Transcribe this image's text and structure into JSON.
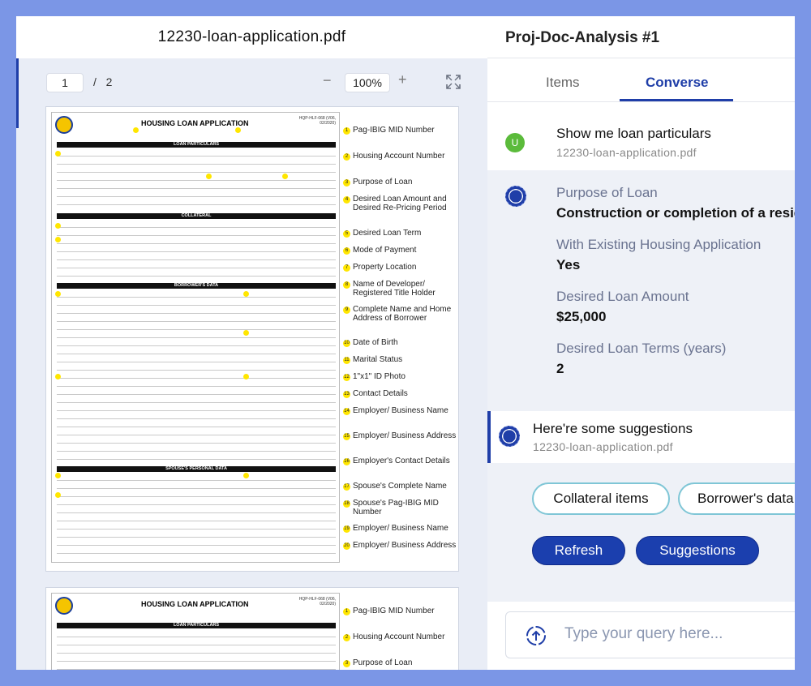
{
  "left_pane": {
    "file_name": "12230-loan-application.pdf",
    "page_current": "1",
    "page_separator": "/",
    "page_total": "2",
    "zoom_minus": "−",
    "zoom_level": "100%",
    "zoom_plus": "+",
    "expand_icon": "expand-arrows-icon"
  },
  "pdf": {
    "title": "HOUSING LOAN APPLICATION",
    "code": "HQP-HLF-068 (V06, 02/2020)",
    "sections": [
      "LOAN PARTICULARS",
      "COLLATERAL",
      "BORROWER'S DATA",
      "SPOUSE'S PERSONAL DATA"
    ],
    "legend": [
      {
        "num": "1",
        "text": "Pag-IBIG MID Number"
      },
      {
        "num": "2",
        "text": "Housing Account Number"
      },
      {
        "num": "3",
        "text": "Purpose of Loan"
      },
      {
        "num": "4",
        "text": "Desired Loan Amount and Desired Re-Pricing Period"
      },
      {
        "num": "5",
        "text": "Desired Loan Term"
      },
      {
        "num": "6",
        "text": "Mode of Payment"
      },
      {
        "num": "7",
        "text": "Property Location"
      },
      {
        "num": "8",
        "text": "Name of Developer/ Registered Title Holder"
      },
      {
        "num": "9",
        "text": "Complete Name and Home Address of Borrower"
      },
      {
        "num": "10",
        "text": "Date of Birth"
      },
      {
        "num": "11",
        "text": "Marital Status"
      },
      {
        "num": "12",
        "text": "1\"x1\" ID Photo"
      },
      {
        "num": "13",
        "text": "Contact Details"
      },
      {
        "num": "14",
        "text": "Employer/ Business Name"
      },
      {
        "num": "15",
        "text": "Employer/ Business Address"
      },
      {
        "num": "16",
        "text": "Employer's Contact Details"
      },
      {
        "num": "17",
        "text": "Spouse's Complete Name"
      },
      {
        "num": "18",
        "text": "Spouse's Pag-IBIG MID Number"
      },
      {
        "num": "19",
        "text": "Employer/ Business Name"
      },
      {
        "num": "20",
        "text": "Employer/ Business Address"
      }
    ],
    "legend_page2": [
      {
        "num": "1",
        "text": "Pag-IBIG MID Number"
      },
      {
        "num": "2",
        "text": "Housing Account Number"
      },
      {
        "num": "3",
        "text": "Purpose of Loan"
      }
    ]
  },
  "right_pane": {
    "project_title": "Proj-Doc-Analysis #1",
    "tabs": [
      {
        "label": "Items"
      },
      {
        "label": "Converse"
      }
    ],
    "user_message": {
      "avatar": "U",
      "title": "Show me loan particulars",
      "source": "12230-loan-application.pdf"
    },
    "answer": {
      "fields": [
        {
          "label": "Purpose of Loan",
          "value": "Construction or completion of a residential unit"
        },
        {
          "label": "With Existing Housing Application",
          "value": "Yes"
        },
        {
          "label": "Desired Loan Amount",
          "value": "$25,000"
        },
        {
          "label": "Desired Loan Terms (years)",
          "value": "2"
        }
      ]
    },
    "suggestion_message": {
      "title": "Here're some suggestions",
      "source": "12230-loan-application.pdf"
    },
    "chips": [
      {
        "label": "Collateral items"
      },
      {
        "label": "Borrower's data"
      }
    ],
    "buttons": {
      "refresh": "Refresh",
      "suggestions": "Suggestions"
    },
    "query": {
      "placeholder": "Type your query here..."
    }
  }
}
